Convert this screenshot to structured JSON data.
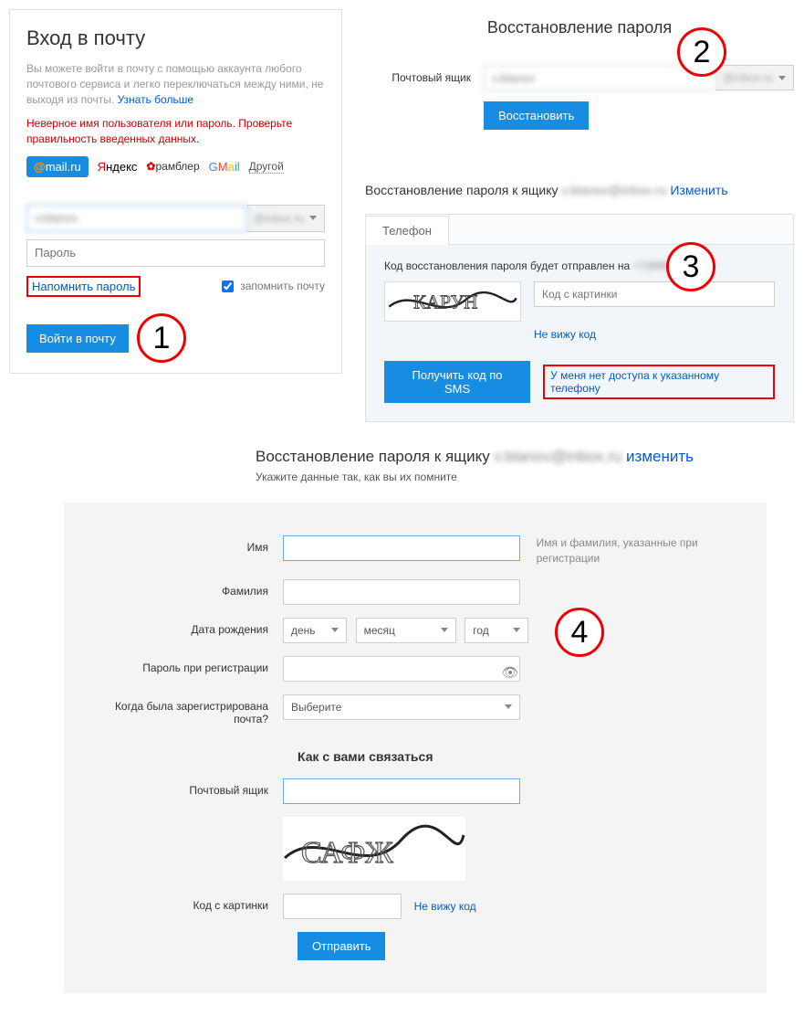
{
  "login": {
    "title": "Вход в почту",
    "intro_prefix": "Вы можете войти в почту с помощью аккаунта любого почтового сервиса и легко переключаться между ними, не выходя из почты. ",
    "intro_link": "Узнать больше",
    "error": "Неверное имя пользователя или пароль. Проверьте правильность введенных данных.",
    "providers": {
      "mailru": "mail.ru",
      "yandex": "Яндекс",
      "rambler": "рамблер",
      "gmail": "GMail",
      "other": "Другой"
    },
    "username_value": "v.blanov",
    "domain_label": "@inbox.ru",
    "password_placeholder": "Пароль",
    "remind_link": "Напомнить пароль",
    "remember_label": "запомнить почту",
    "submit": "Войти в почту"
  },
  "recover": {
    "title": "Восстановление пароля",
    "mailbox_label": "Почтовый ящик",
    "mail_value": "v.blanov",
    "domain": "@inbox.ru",
    "submit": "Восстановить"
  },
  "phone": {
    "title_prefix": "Восстановление пароля к ящику ",
    "title_mail": "v.blanov@inbox.ru",
    "change_link": "Изменить",
    "tab_label": "Телефон",
    "sent_prefix": "Код восстановления пароля будет отправлен на ",
    "sent_number": "+7(999) 999-**-**",
    "code_placeholder": "Код с картинки",
    "no_code": "Не вижу код",
    "sms_btn": "Получить код по SMS",
    "no_access": "У меня нет доступа к указанному телефону"
  },
  "form4": {
    "title_prefix": "Восстановление пароля к ящику ",
    "title_mail": "v.blanov@inbox.ru",
    "change_link": "изменить",
    "subtitle": "Укажите данные так, как вы их помните",
    "labels": {
      "name": "Имя",
      "surname": "Фамилия",
      "dob": "Дата рождения",
      "reg_password": "Пароль при регистрации",
      "when_reg": "Когда была зарегистрирована почта?",
      "contact_h": "Как с вами связаться",
      "mailbox": "Почтовый ящик",
      "captcha_code": "Код с картинки"
    },
    "hints": {
      "name": "Имя и фамилия, указанные при регистрации"
    },
    "selects": {
      "day": "день",
      "month": "месяц",
      "year": "год",
      "choose": "Выберите"
    },
    "no_code": "Не вижу код",
    "submit": "Отправить"
  },
  "callouts": {
    "c1": "1",
    "c2": "2",
    "c3": "3",
    "c4": "4"
  }
}
